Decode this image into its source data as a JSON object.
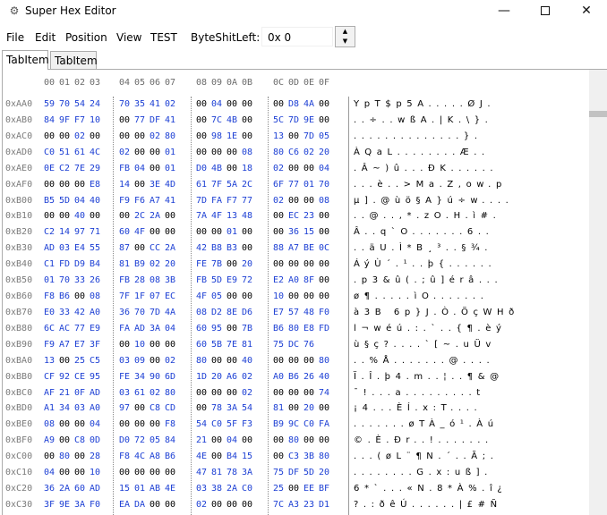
{
  "window": {
    "title": "Super Hex Editor",
    "icon": "gear-icon",
    "controls": [
      "minimize",
      "maximize",
      "close"
    ]
  },
  "menu": {
    "file": "File",
    "edit": "Edit",
    "position": "Position",
    "view": "View",
    "test": "TEST",
    "byte_shift_label": "ByteShitLeft:",
    "byte_shift_value": "0x 0"
  },
  "tabs": [
    {
      "label": "TabItem",
      "selected": true
    },
    {
      "label": "TabItem",
      "selected": false
    }
  ],
  "hex": {
    "column_headers": [
      "00",
      "01",
      "02",
      "03",
      "04",
      "05",
      "06",
      "07",
      "08",
      "09",
      "0A",
      "0B",
      "0C",
      "0D",
      "0E",
      "0F"
    ],
    "rows": [
      {
        "addr": "0xAA0",
        "bytes": [
          "59",
          "70",
          "54",
          "24",
          "70",
          "35",
          "41",
          "02",
          "00",
          "04",
          "00",
          "00",
          "00",
          "D8",
          "4A",
          "00"
        ],
        "ascii": "YpT$p5A.....ØJ."
      },
      {
        "addr": "0xAB0",
        "bytes": [
          "84",
          "9F",
          "F7",
          "10",
          "00",
          "77",
          "DF",
          "41",
          "00",
          "7C",
          "4B",
          "00",
          "5C",
          "7D",
          "9E",
          "00"
        ],
        "ascii": "..÷..wßA.|K.\\}."
      },
      {
        "addr": "0xAC0",
        "bytes": [
          "00",
          "00",
          "02",
          "00",
          "00",
          "00",
          "02",
          "80",
          "00",
          "98",
          "1E",
          "00",
          "13",
          "00",
          "7D",
          "05"
        ],
        "ascii": "..............}."
      },
      {
        "addr": "0xAD0",
        "bytes": [
          "C0",
          "51",
          "61",
          "4C",
          "02",
          "00",
          "00",
          "01",
          "00",
          "00",
          "00",
          "08",
          "80",
          "C6",
          "02",
          "20"
        ],
        "ascii": "ÀQaL........Æ.."
      },
      {
        "addr": "0xAE0",
        "bytes": [
          "0E",
          "C2",
          "7E",
          "29",
          "FB",
          "04",
          "00",
          "01",
          "D0",
          "4B",
          "00",
          "18",
          "02",
          "00",
          "00",
          "04"
        ],
        "ascii": ".Â~)û...ÐK......"
      },
      {
        "addr": "0xAF0",
        "bytes": [
          "00",
          "00",
          "00",
          "E8",
          "14",
          "00",
          "3E",
          "4D",
          "61",
          "7F",
          "5A",
          "2C",
          "6F",
          "77",
          "01",
          "70"
        ],
        "ascii": "...è..>Ma.Z,ow.p"
      },
      {
        "addr": "0xB00",
        "bytes": [
          "B5",
          "5D",
          "04",
          "40",
          "F9",
          "F6",
          "A7",
          "41",
          "7D",
          "FA",
          "F7",
          "77",
          "02",
          "00",
          "00",
          "08"
        ],
        "ascii": "µ].@ùö§A}ú÷w...."
      },
      {
        "addr": "0xB10",
        "bytes": [
          "00",
          "00",
          "40",
          "00",
          "00",
          "2C",
          "2A",
          "00",
          "7A",
          "4F",
          "13",
          "48",
          "00",
          "EC",
          "23",
          "00"
        ],
        "ascii": "..@..,*.zO.H.ì#."
      },
      {
        "addr": "0xB20",
        "bytes": [
          "C2",
          "14",
          "97",
          "71",
          "60",
          "4F",
          "00",
          "00",
          "00",
          "00",
          "01",
          "00",
          "00",
          "36",
          "15",
          "00"
        ],
        "ascii": "Â..q`O.......6.."
      },
      {
        "addr": "0xB30",
        "bytes": [
          "AD",
          "03",
          "E4",
          "55",
          "87",
          "00",
          "CC",
          "2A",
          "42",
          "B8",
          "B3",
          "00",
          "88",
          "A7",
          "BE",
          "0C"
        ],
        "ascii": "..äU.Ì*B¸³..§¾."
      },
      {
        "addr": "0xB40",
        "bytes": [
          "C1",
          "FD",
          "D9",
          "B4",
          "81",
          "B9",
          "02",
          "20",
          "FE",
          "7B",
          "00",
          "20",
          "00",
          "00",
          "00",
          "00"
        ],
        "ascii": "ÁýÙ´.¹..þ{......"
      },
      {
        "addr": "0xB50",
        "bytes": [
          "01",
          "70",
          "33",
          "26",
          "FB",
          "28",
          "08",
          "3B",
          "FB",
          "5D",
          "E9",
          "72",
          "E2",
          "A0",
          "8F",
          "00"
        ],
        "ascii": ".p3&û(.;û]érâ..."
      },
      {
        "addr": "0xB60",
        "bytes": [
          "F8",
          "B6",
          "00",
          "08",
          "7F",
          "1F",
          "07",
          "EC",
          "4F",
          "05",
          "00",
          "00",
          "10",
          "00",
          "00",
          "00"
        ],
        "ascii": "ø¶.....ìO......."
      },
      {
        "addr": "0xB70",
        "bytes": [
          "E0",
          "33",
          "42",
          "A0",
          "36",
          "70",
          "7D",
          "4A",
          "08",
          "D2",
          "8E",
          "D6",
          "E7",
          "57",
          "48",
          "F0"
        ],
        "ascii": "à3B 6p}J.Ò.ÖçWHð"
      },
      {
        "addr": "0xB80",
        "bytes": [
          "6C",
          "AC",
          "77",
          "E9",
          "FA",
          "AD",
          "3A",
          "04",
          "60",
          "95",
          "00",
          "7B",
          "B6",
          "80",
          "E8",
          "FD"
        ],
        "ascii": "l¬wéú.:.`..{¶.èý"
      },
      {
        "addr": "0xB90",
        "bytes": [
          "F9",
          "A7",
          "E7",
          "3F",
          "00",
          "10",
          "00",
          "00",
          "60",
          "5B",
          "7E",
          "81",
          "75",
          "DC",
          "76"
        ],
        "ascii": "ù§ç?....`[~.uÜv"
      },
      {
        "addr": "0xBA0",
        "bytes": [
          "13",
          "00",
          "25",
          "C5",
          "03",
          "09",
          "00",
          "02",
          "80",
          "00",
          "00",
          "40",
          "00",
          "00",
          "00",
          "80"
        ],
        "ascii": "..%Å.......@...."
      },
      {
        "addr": "0xBB0",
        "bytes": [
          "CF",
          "92",
          "CE",
          "95",
          "FE",
          "34",
          "90",
          "6D",
          "1D",
          "20",
          "A6",
          "02",
          "A0",
          "B6",
          "26",
          "40"
        ],
        "ascii": "Ï.Î.þ4.m..¦..¶&@"
      },
      {
        "addr": "0xBC0",
        "bytes": [
          "AF",
          "21",
          "0F",
          "AD",
          "03",
          "61",
          "02",
          "80",
          "00",
          "00",
          "00",
          "02",
          "00",
          "00",
          "00",
          "74"
        ],
        "ascii": "¯!...a.........t"
      },
      {
        "addr": "0xBD0",
        "bytes": [
          "A1",
          "34",
          "03",
          "A0",
          "97",
          "00",
          "C8",
          "CD",
          "00",
          "78",
          "3A",
          "54",
          "81",
          "00",
          "20",
          "00"
        ],
        "ascii": "¡4...ÈÍ.x:T...."
      },
      {
        "addr": "0xBE0",
        "bytes": [
          "08",
          "00",
          "00",
          "04",
          "00",
          "00",
          "00",
          "F8",
          "54",
          "C0",
          "5F",
          "F3",
          "B9",
          "9C",
          "C0",
          "FA"
        ],
        "ascii": ".......øTÀ_ó¹.Àú"
      },
      {
        "addr": "0xBF0",
        "bytes": [
          "A9",
          "00",
          "C8",
          "0D",
          "D0",
          "72",
          "05",
          "84",
          "21",
          "00",
          "04",
          "00",
          "00",
          "80",
          "00",
          "00"
        ],
        "ascii": "©.È.Ðr..!......."
      },
      {
        "addr": "0xC00",
        "bytes": [
          "00",
          "80",
          "00",
          "28",
          "F8",
          "4C",
          "A8",
          "B6",
          "4E",
          "00",
          "B4",
          "15",
          "00",
          "C3",
          "3B",
          "80"
        ],
        "ascii": "...(øL¨¶N.´..Ã;."
      },
      {
        "addr": "0xC10",
        "bytes": [
          "04",
          "00",
          "00",
          "10",
          "00",
          "00",
          "00",
          "00",
          "47",
          "81",
          "78",
          "3A",
          "75",
          "DF",
          "5D",
          "20"
        ],
        "ascii": "........G.x:uß]."
      },
      {
        "addr": "0xC20",
        "bytes": [
          "36",
          "2A",
          "60",
          "AD",
          "15",
          "01",
          "AB",
          "4E",
          "03",
          "38",
          "2A",
          "C0",
          "25",
          "00",
          "EE",
          "BF"
        ],
        "ascii": "6*`...«N.8*À%.î¿"
      },
      {
        "addr": "0xC30",
        "bytes": [
          "3F",
          "9E",
          "3A",
          "F0",
          "EA",
          "DA",
          "00",
          "00",
          "02",
          "00",
          "00",
          "00",
          "7C",
          "A3",
          "23",
          "D1"
        ],
        "ascii": "?.:ðêÚ......|£#Ñ"
      }
    ]
  },
  "colors": {
    "zero_byte": "#000000",
    "nonzero_byte": "#1c3fd4",
    "address": "#7a7a7a",
    "header": "#6b6b6b"
  }
}
